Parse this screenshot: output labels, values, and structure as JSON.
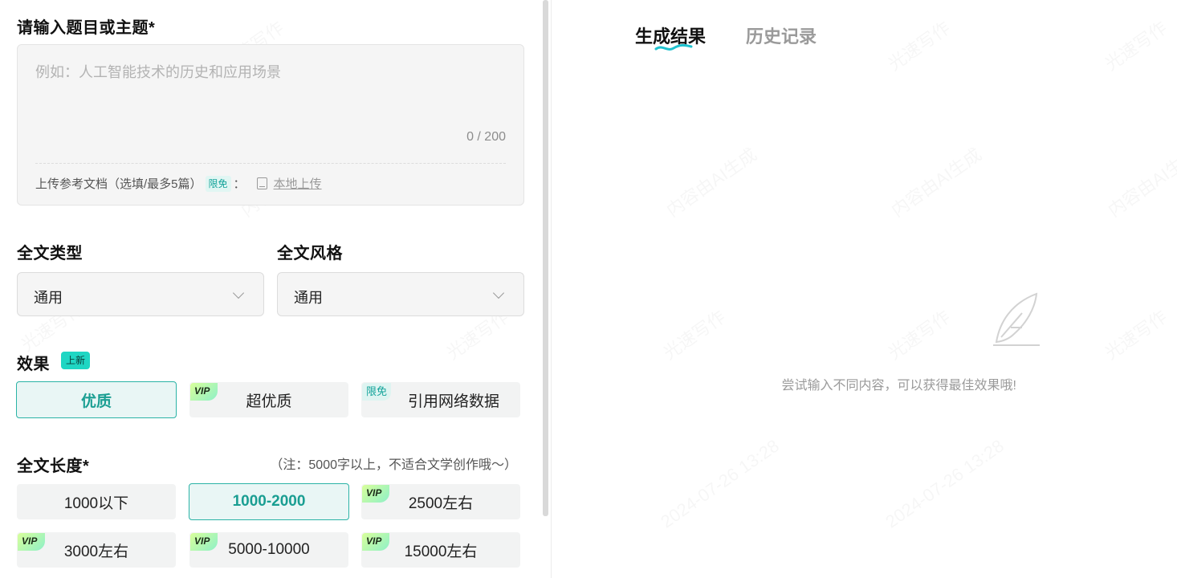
{
  "topic": {
    "title": "请输入题目或主题*",
    "placeholder": "例如：人工智能技术的历史和应用场景",
    "counter": "0 / 200",
    "upload_label": "上传参考文档（选填/最多5篇）",
    "upload_tag": "限免",
    "upload_colon": "：",
    "upload_link": "本地上传"
  },
  "type_select": {
    "label": "全文类型",
    "value": "通用"
  },
  "style_select": {
    "label": "全文风格",
    "value": "通用"
  },
  "effect": {
    "label": "效果",
    "badge": "上新",
    "options": [
      {
        "label": "优质",
        "selected": true,
        "vip": false,
        "free": false
      },
      {
        "label": "超优质",
        "selected": false,
        "vip": true,
        "free": false
      },
      {
        "label": "引用网络数据",
        "selected": false,
        "vip": false,
        "free": true
      }
    ],
    "vip_tag": "VIP",
    "free_tag": "限免"
  },
  "length": {
    "label": "全文长度*",
    "note": "（注：5000字以上，不适合文学创作哦～）",
    "options": [
      {
        "label": "1000以下",
        "selected": false,
        "vip": false
      },
      {
        "label": "1000-2000",
        "selected": true,
        "vip": false
      },
      {
        "label": "2500左右",
        "selected": false,
        "vip": true
      },
      {
        "label": "3000左右",
        "selected": false,
        "vip": true
      },
      {
        "label": "5000-10000",
        "selected": false,
        "vip": true
      },
      {
        "label": "15000左右",
        "selected": false,
        "vip": true
      }
    ]
  },
  "results": {
    "tabs": [
      {
        "label": "生成结果",
        "active": true
      },
      {
        "label": "历史记录",
        "active": false
      }
    ],
    "empty_icon": "feather-icon",
    "empty_text": "尝试输入不同内容，可以获得最佳效果哦!"
  },
  "colors": {
    "accent": "#2bb3a6",
    "accent_bg": "#e9f6f5",
    "badge": "#1fd6c3"
  }
}
